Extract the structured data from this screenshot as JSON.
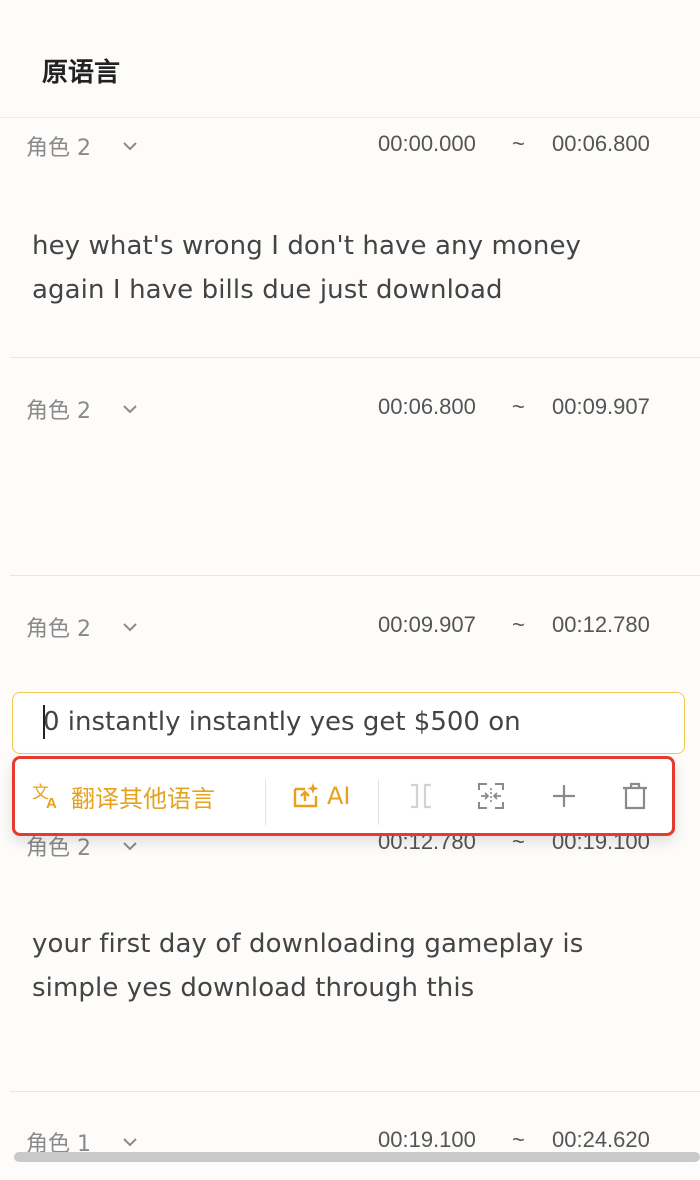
{
  "header": {
    "title": "原语言"
  },
  "segments": [
    {
      "role": "角色 2",
      "start": "00:00.000",
      "tilde": "~",
      "end": "00:06.800",
      "text_lines": [
        "hey what's wrong I don't have any money",
        "again I have bills due just download"
      ]
    },
    {
      "role": "角色 2",
      "start": "00:06.800",
      "tilde": "~",
      "end": "00:09.907",
      "text_lines": []
    },
    {
      "role": "角色 2",
      "start": "00:09.907",
      "tilde": "~",
      "end": "00:12.780",
      "edit_text": "0 instantly instantly yes get $500 on"
    },
    {
      "role": "角色 2",
      "start": "00:12.780",
      "tilde": "~",
      "end": "00:19.100",
      "text_lines": [
        "your first day of downloading gameplay is",
        "simple yes download through this"
      ]
    },
    {
      "role": "角色 1",
      "start": "00:19.100",
      "tilde": "~",
      "end": "00:24.620"
    }
  ],
  "toolbar": {
    "translate_label": "翻译其他语言",
    "ai_label": "AI",
    "icons": [
      "translate-icon",
      "ai-rewrite-icon",
      "split-icon",
      "merge-icon",
      "add-icon",
      "delete-icon"
    ],
    "accent_color": "#e6a21c",
    "highlight_color": "#e53a2f"
  }
}
